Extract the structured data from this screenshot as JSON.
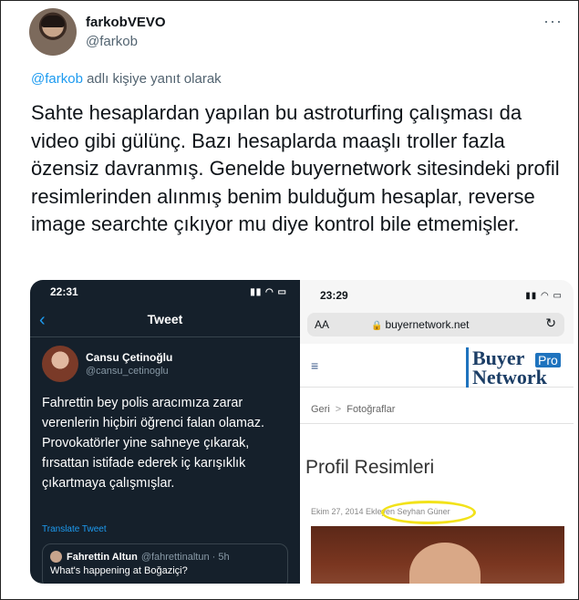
{
  "author": {
    "display_name": "farkobVEVO",
    "handle": "@farkob"
  },
  "more_icon": "more-horizontal-icon",
  "reply": {
    "mention": "@farkob",
    "suffix": " adlı kişiye yanıt olarak"
  },
  "tweet_text": "Sahte hesaplardan yapılan bu astroturfing çalışması da video gibi gülünç. Bazı hesaplarda maaşlı troller fazla özensiz davranmış. Genelde buyernetwork sitesindeki profil resimlerinden alınmış benim bulduğum hesaplar, reverse image searchte çıkıyor mu diye kontrol bile etmemişler.",
  "left_shot": {
    "time": "22:31",
    "nav_title": "Tweet",
    "user_name": "Cansu Çetinoğlu",
    "user_handle": "@cansu_cetinoglu",
    "body": "Fahrettin bey polis aracımıza zarar verenlerin hiçbiri öğrenci falan olamaz. Provokatörler yine sahneye çıkarak, fırsattan istifade ederek iç karışıklık çıkartmaya çalışmışlar.",
    "translate": "Translate Tweet",
    "quote_name": "Fahrettin Altun",
    "quote_handle": "@fahrettinaltun · 5h",
    "quote_text": "What's happening at Boğaziçi?"
  },
  "right_shot": {
    "time": "23:29",
    "aa": "AA",
    "url": "buyernetwork.net",
    "logo_line1": "Buyer",
    "logo_pro": "Pro",
    "logo_line2": "Network",
    "crumb_back": "Geri",
    "crumb_sep": ">",
    "crumb_current": "Fotoğraflar",
    "page_title": "Profil Resimleri",
    "meta": "Ekim 27, 2014 Ekleyen Seyhan Güner"
  },
  "colors": {
    "accent": "#1d9bf0",
    "dark_bg": "#15202b",
    "highlight": "#f2e21a"
  }
}
